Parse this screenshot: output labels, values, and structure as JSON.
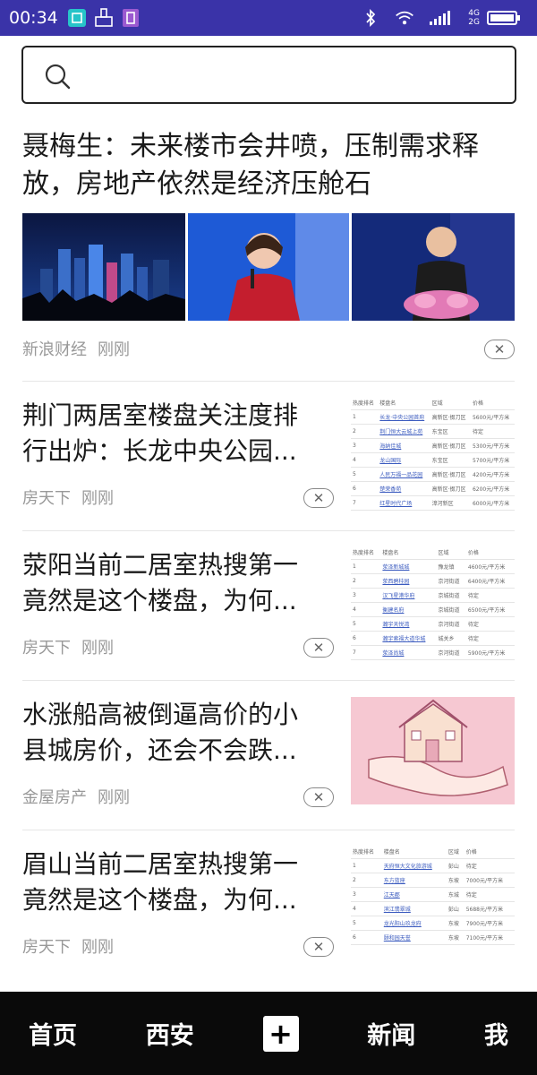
{
  "status_bar": {
    "time": "00:34",
    "network": "4G",
    "network2": "2G"
  },
  "search": {
    "placeholder": ""
  },
  "articles": [
    {
      "title": "聂梅生：未来楼市会井喷，压制需求释放，房地产依然是经济压舱石",
      "source": "新浪财经",
      "time": "刚刚"
    },
    {
      "title_line1": "荆门两居室楼盘关注度排",
      "title_line2": "行出炉：长龙中央公园...",
      "source": "房天下",
      "time": "刚刚",
      "table": {
        "headers": [
          "热度排名",
          "楼盘名",
          "区域",
          "价格"
        ],
        "rows": [
          [
            "1",
            "长龙·中央公园首府",
            "高新区·掇刀区",
            "5600元/平方米"
          ],
          [
            "2",
            "荆门恒大云城上苑",
            "东宝区",
            "待定"
          ],
          [
            "3",
            "海纳佳城",
            "高新区·掇刀区",
            "5300元/平方米"
          ],
          [
            "4",
            "龙山国际",
            "东宝区",
            "5700元/平方米"
          ],
          [
            "5",
            "人民万福一品花园",
            "高新区·掇刀区",
            "4200元/平方米"
          ],
          [
            "6",
            "楚荣香苑",
            "高新区·掇刀区",
            "6200元/平方米"
          ],
          [
            "7",
            "红星时代广场",
            "漳河新区",
            "6000元/平方米"
          ]
        ]
      }
    },
    {
      "title_line1": "荥阳当前二居室热搜第一",
      "title_line2": "竟然是这个楼盘，为何...",
      "source": "房天下",
      "time": "刚刚",
      "table": {
        "headers": [
          "热度排名",
          "楼盘名",
          "区域",
          "价格"
        ],
        "rows": [
          [
            "1",
            "荥泽新城城",
            "豫龙镇",
            "4600元/平方米"
          ],
          [
            "2",
            "荥西碧桂园",
            "京河街道",
            "6400元/平方米"
          ],
          [
            "3",
            "汉飞星港华府",
            "京城街道",
            "待定"
          ],
          [
            "4",
            "衡建名府",
            "京城街道",
            "6500元/平方米"
          ],
          [
            "5",
            "瀚宇天悦湾",
            "京河街道",
            "待定"
          ],
          [
            "6",
            "瀚宇索福大道华城",
            "城关乡",
            "待定"
          ],
          [
            "7",
            "荥泽尚城",
            "京河街道",
            "5900元/平方米"
          ]
        ]
      }
    },
    {
      "title_line1": "水涨船高被倒逼高价的小",
      "title_line2": "县城房价，还会不会跌...",
      "source": "金屋房产",
      "time": "刚刚"
    },
    {
      "title_line1": "眉山当前二居室热搜第一",
      "title_line2": "竟然是这个楼盘，为何...",
      "source": "房天下",
      "time": "刚刚",
      "table": {
        "headers": [
          "热度排名",
          "楼盘名",
          "区域",
          "价格"
        ],
        "rows": [
          [
            "1",
            "天府恒大文化旅游城",
            "彭山",
            "待定"
          ],
          [
            "2",
            "东方蓝座",
            "东坡",
            "7000元/平方米"
          ],
          [
            "3",
            "江天郡",
            "东城",
            "待定"
          ],
          [
            "4",
            "滨江翡翠城",
            "彭山",
            "5688元/平方米"
          ],
          [
            "5",
            "龙光阳山玖龙府",
            "东坡",
            "7900元/平方米"
          ],
          [
            "6",
            "颐和园天誉",
            "东坡",
            "7100元/平方米"
          ]
        ]
      }
    }
  ],
  "close_glyph": "✕",
  "bottom_nav": {
    "home": "首页",
    "city": "西安",
    "plus": "+",
    "news": "新闻",
    "me": "我"
  },
  "colors": {
    "status_bar": "#3a33a8",
    "nav_bg": "#0a0a0a",
    "link": "#3b5bbf"
  }
}
